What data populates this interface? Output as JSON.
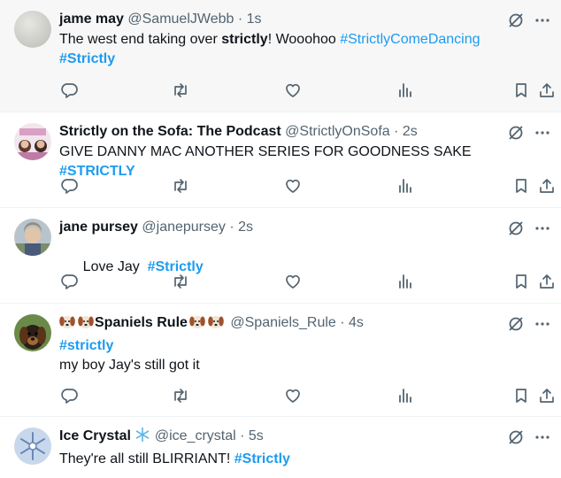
{
  "tweets": [
    {
      "name": "jame may",
      "handle": "@SamuelJWebb",
      "time": "1s",
      "text_parts": [
        "The west end taking over ",
        "strictly",
        "! Wooohoo ",
        "#StrictlyComeDancing"
      ],
      "line2_tag": "#Strictly"
    },
    {
      "name": "Strictly on the Sofa: The Podcast",
      "handle": "@StrictlyOnSofa",
      "time": "2s",
      "text_parts": [
        "GIVE DANNY MAC ANOTHER SERIES FOR GOODNESS SAKE ",
        "#STRICTLY"
      ]
    },
    {
      "name": "jane pursey",
      "handle": "@janepursey",
      "time": "2s",
      "text_parts": [
        "Love Jay  ",
        "#Strictly"
      ]
    },
    {
      "name": "Spaniels Rule",
      "name_emoji": "dog-face-emoji",
      "handle": "@Spaniels_Rule",
      "time": "4s",
      "text_parts": [
        "#strictly",
        "my boy Jay's still got it"
      ]
    },
    {
      "name": "Ice Crystal",
      "name_emoji": "snowflake-emoji",
      "handle": "@ice_crystal",
      "time": "5s",
      "text_parts": [
        "They're all still BLIRRIANT! ",
        "#Strictly"
      ]
    }
  ],
  "separator": "·",
  "icons": {
    "reply": "reply-icon",
    "retweet": "retweet-icon",
    "like": "like-icon",
    "views": "views-icon",
    "bookmark": "bookmark-icon",
    "share": "share-icon",
    "grok": "grok-icon",
    "more": "more-icon"
  },
  "colors": {
    "link": "#1d9bf0",
    "secondary": "#536471",
    "icon": "#536471",
    "highlight_bg": "#f7f7f7"
  }
}
